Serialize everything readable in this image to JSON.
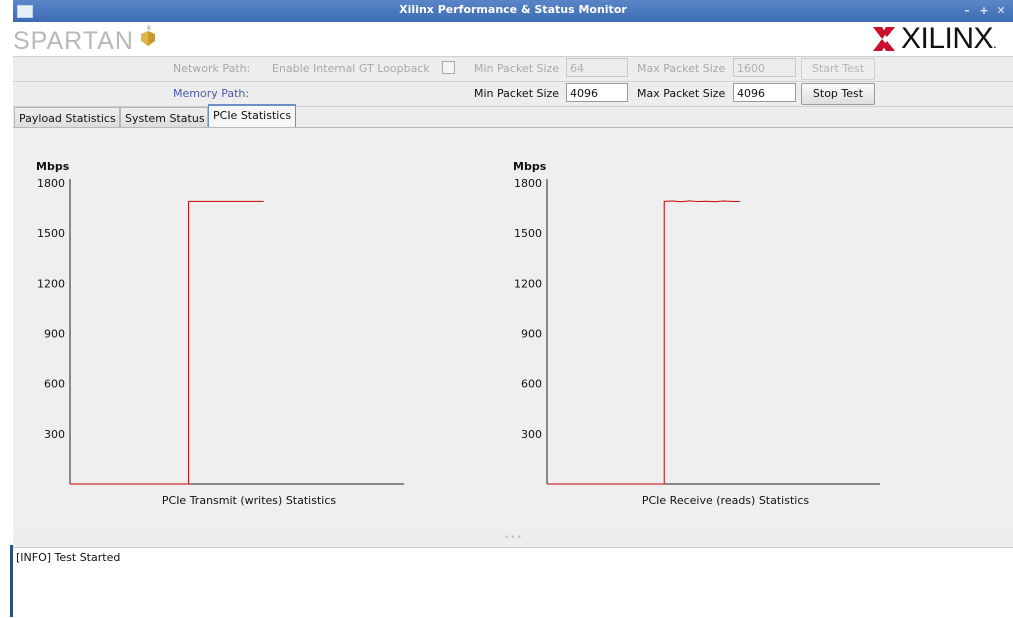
{
  "window": {
    "title": "Xilinx Performance & Status Monitor"
  },
  "brand": {
    "left_logo": "SPARTAN",
    "left_logo_badge": "6",
    "right_logo": "XILINX",
    "right_logo_suffix": "."
  },
  "network_row": {
    "path_label": "Network Path:",
    "loopback_label": "Enable Internal GT Loopback",
    "min_label": "Min Packet Size",
    "min_value": "64",
    "max_label": "Max Packet Size",
    "max_value": "1600",
    "button": "Start Test"
  },
  "memory_row": {
    "path_label": "Memory Path:",
    "min_label": "Min Packet Size",
    "min_value": "4096",
    "max_label": "Max Packet Size",
    "max_value": "4096",
    "button": "Stop Test"
  },
  "tabs": [
    {
      "label": "Payload Statistics",
      "active": false
    },
    {
      "label": "System Status",
      "active": false
    },
    {
      "label": "PCIe Statistics",
      "active": true
    }
  ],
  "chart_data": [
    {
      "type": "line",
      "title": "",
      "xlabel": "PCIe Transmit (writes) Statistics",
      "ylabel": "Mbps",
      "ylim": [
        0,
        1800
      ],
      "yticks": [
        300,
        600,
        900,
        1200,
        1500,
        1800
      ],
      "grid": false,
      "series": [
        {
          "color": "#cc0000",
          "values": [
            0,
            0,
            0,
            0,
            0,
            0,
            0,
            0,
            0,
            0,
            0,
            0,
            0,
            0,
            0,
            1690,
            1690,
            1690,
            1690,
            1690,
            1690,
            1690,
            1690,
            1690,
            1690
          ]
        }
      ]
    },
    {
      "type": "line",
      "title": "",
      "xlabel": "PCIe Receive (reads) Statistics",
      "ylabel": "Mbps",
      "ylim": [
        0,
        1800
      ],
      "yticks": [
        300,
        600,
        900,
        1200,
        1500,
        1800
      ],
      "grid": false,
      "series": [
        {
          "color": "#cc0000",
          "values": [
            0,
            0,
            0,
            0,
            0,
            0,
            0,
            0,
            0,
            0,
            0,
            0,
            0,
            0,
            0,
            1690,
            1692,
            1688,
            1693,
            1689,
            1691,
            1688,
            1692,
            1690,
            1689
          ]
        }
      ]
    }
  ],
  "log": {
    "lines": [
      "[INFO] Test Started"
    ]
  },
  "colors": {
    "titlebar": "#3d6cb3",
    "series": "#cc0000",
    "path_label": "#4a5aa8",
    "xilinx_mark": "#c8102e"
  }
}
